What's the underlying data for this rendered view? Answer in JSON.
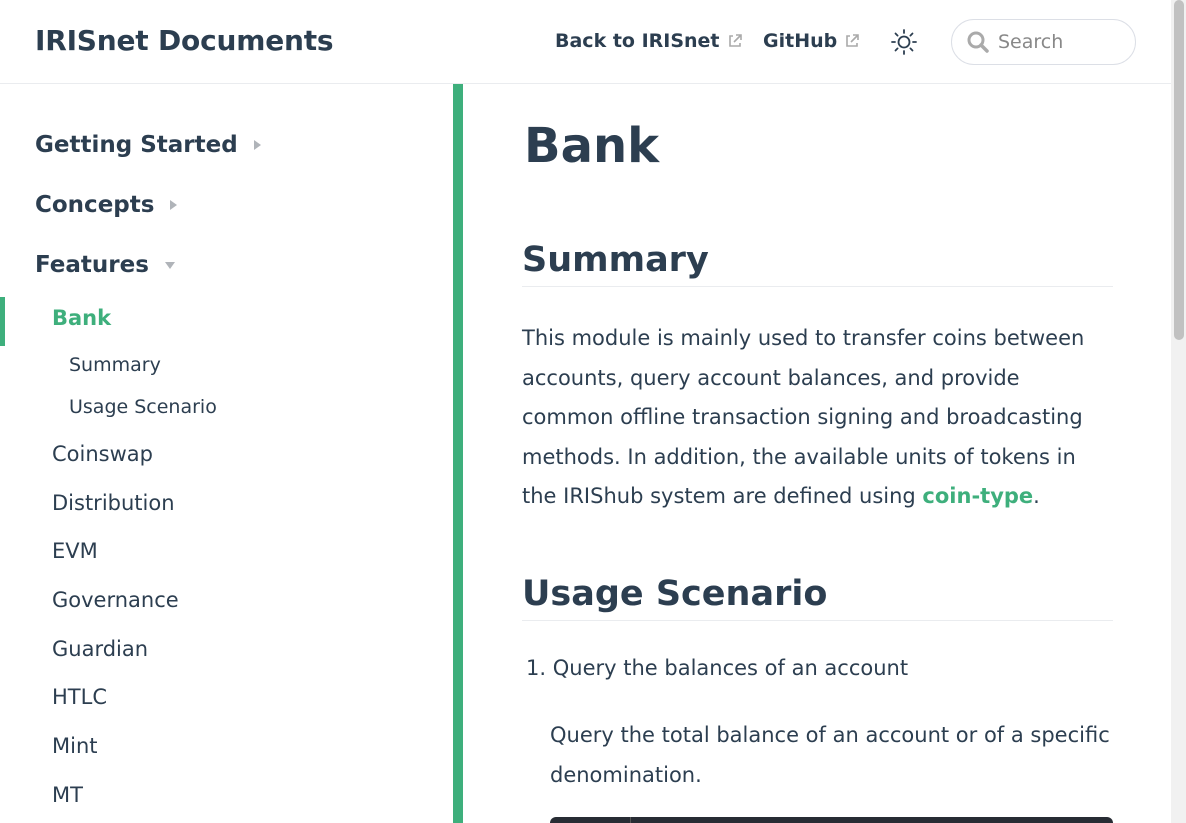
{
  "navbar": {
    "title": "IRISnet Documents",
    "back_link": "Back to IRISnet",
    "github_link": "GitHub",
    "search_placeholder": "Search",
    "icons": {
      "external": "external-link-icon",
      "theme": "sun-icon",
      "search": "search-icon"
    }
  },
  "sidebar": {
    "groups": [
      {
        "label": "Getting Started",
        "expanded": false
      },
      {
        "label": "Concepts",
        "expanded": false
      },
      {
        "label": "Features",
        "expanded": true
      }
    ],
    "active_item": "Bank",
    "sub_items": [
      "Summary",
      "Usage Scenario"
    ],
    "items": [
      "Coinswap",
      "Distribution",
      "EVM",
      "Governance",
      "Guardian",
      "HTLC",
      "Mint",
      "MT"
    ]
  },
  "content": {
    "title": "Bank",
    "summary_heading": "Summary",
    "summary_text": "This module is mainly used to transfer coins between accounts, query account balances, and provide common offline transaction signing and broadcasting methods. In addition, the available units of tokens in the IRIShub system are defined using ",
    "summary_link": "coin-type",
    "summary_end": ".",
    "usage_heading": "Usage Scenario",
    "list_number": "1.",
    "list_item_1": "Query the balances of an account",
    "list_item_1_desc": "Query the total balance of an account or of a specific denomination."
  },
  "colors": {
    "accent": "#3eaf7c",
    "text": "#2c3e50",
    "border": "#eaecef"
  }
}
